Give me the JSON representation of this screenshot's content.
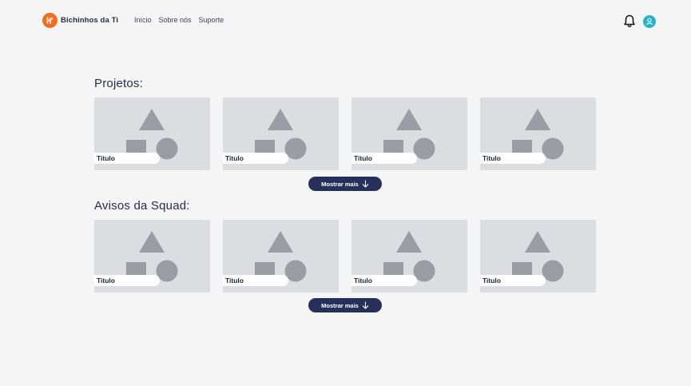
{
  "header": {
    "brand": "Bichinhos da Ti",
    "nav": [
      "Início",
      "Sobre nós",
      "Suporte"
    ]
  },
  "projects": {
    "title": "Projetos:",
    "cards": [
      {
        "label": "Titulo"
      },
      {
        "label": "Titulo"
      },
      {
        "label": "Titulo"
      },
      {
        "label": "Titulo"
      }
    ],
    "more_label": "Mostrar mais"
  },
  "notices": {
    "title": "Avisos da Squad:",
    "cards": [
      {
        "label": "Titulo"
      },
      {
        "label": "Titulo"
      },
      {
        "label": "Titulo"
      },
      {
        "label": "Titulo"
      }
    ],
    "more_label": "Mostrar mais"
  },
  "colors": {
    "brand_orange": "#f36d21",
    "navy": "#27305a",
    "avatar_teal": "#2ab3c6",
    "card_bg": "#dcdde1",
    "shape_gray": "#9a9da3"
  },
  "icons": {
    "logo": "logo-icon",
    "notification": "bell-icon",
    "profile": "user-icon",
    "more_arrow": "arrow-down-icon",
    "card_placeholder": "image-placeholder-icon"
  }
}
